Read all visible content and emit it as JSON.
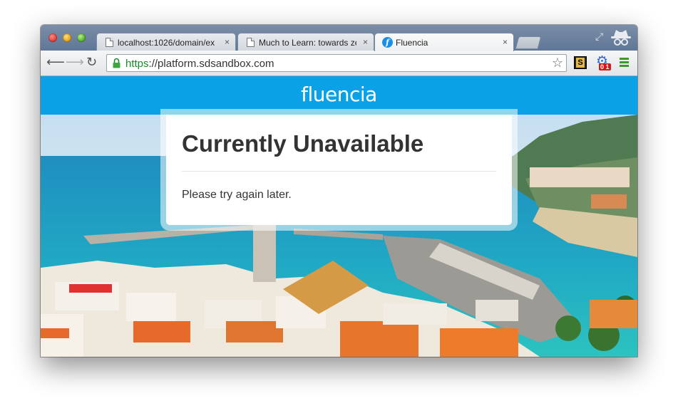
{
  "browser": {
    "tabs": [
      {
        "title": "localhost:1026/domain/ex",
        "favicon": "document-icon",
        "active": false
      },
      {
        "title": "Much to Learn: towards ze",
        "favicon": "document-icon",
        "active": false
      },
      {
        "title": "Fluencia",
        "favicon": "fluencia-f-icon",
        "active": true
      }
    ],
    "tab_close_glyph": "×",
    "url_scheme": "https",
    "url_separator": "://",
    "url_host": "platform.sdsandbox.com",
    "extension_badge": "0 1"
  },
  "page": {
    "brand": "fluencia",
    "heading": "Currently Unavailable",
    "message": "Please try again later."
  },
  "colors": {
    "brand_blue": "#0aa1e6",
    "secure_green": "#1a8a2a"
  }
}
